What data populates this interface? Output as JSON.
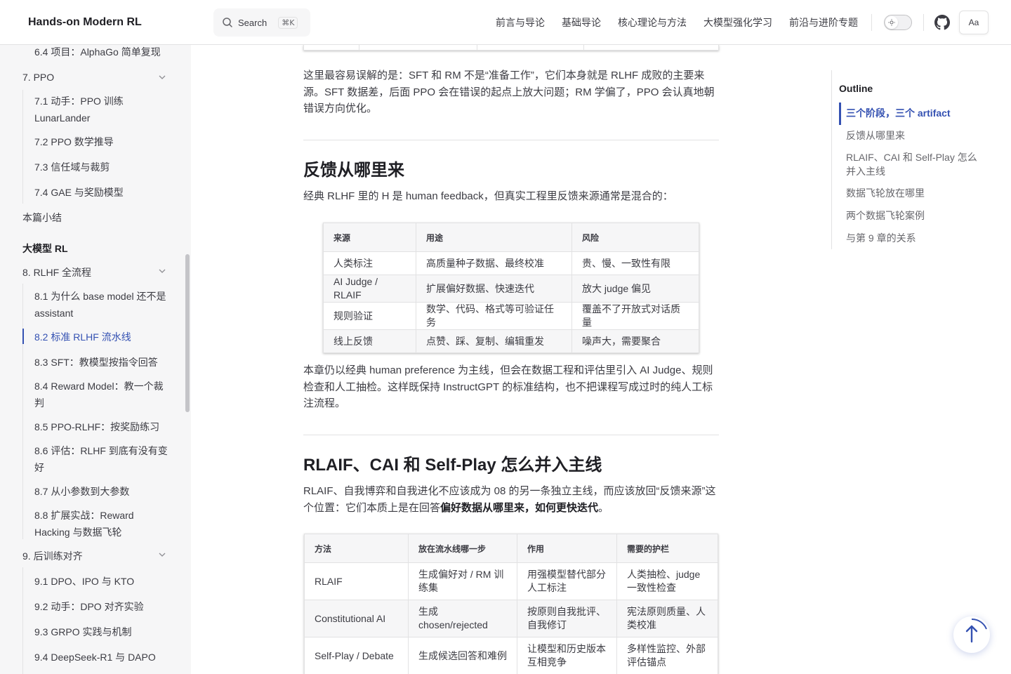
{
  "header": {
    "brand": "Hands-on Modern RL",
    "search_label": "Search",
    "search_shortcut": "⌘K",
    "nav": [
      "前言与导论",
      "基础导论",
      "核心理论与方法",
      "大模型强化学习",
      "前沿与进阶专题"
    ],
    "appearance_label": "Aa"
  },
  "sidebar": {
    "items": [
      {
        "label": "6.4 项目：AlphaGo 简单复现",
        "kind": "sub"
      },
      {
        "label": "7. PPO",
        "kind": "section"
      },
      {
        "label": "7.1 动手：PPO 训练 LunarLander",
        "kind": "sub"
      },
      {
        "label": "7.2 PPO 数学推导",
        "kind": "sub"
      },
      {
        "label": "7.3 信任域与裁剪",
        "kind": "sub"
      },
      {
        "label": "7.4 GAE 与奖励模型",
        "kind": "sub"
      },
      {
        "label": "本篇小结",
        "kind": "section"
      },
      {
        "label": "大模型 RL",
        "kind": "group"
      },
      {
        "label": "8. RLHF 全流程",
        "kind": "section"
      },
      {
        "label": "8.1 为什么 base model 还不是 assistant",
        "kind": "sub"
      },
      {
        "label": "8.2 标准 RLHF 流水线",
        "kind": "sub-active"
      },
      {
        "label": "8.3 SFT：教模型按指令回答",
        "kind": "sub"
      },
      {
        "label": "8.4 Reward Model：教一个裁判",
        "kind": "sub"
      },
      {
        "label": "8.5 PPO-RLHF：按奖励练习",
        "kind": "sub"
      },
      {
        "label": "8.6 评估：RLHF 到底有没有变好",
        "kind": "sub"
      },
      {
        "label": "8.7 从小参数到大参数",
        "kind": "sub"
      },
      {
        "label": "8.8 扩展实战：Reward Hacking 与数据飞轮",
        "kind": "sub"
      },
      {
        "label": "9. 后训练对齐",
        "kind": "section"
      },
      {
        "label": "9.1 DPO、IPO 与 KTO",
        "kind": "sub"
      },
      {
        "label": "9.2 动手：DPO 对齐实验",
        "kind": "sub"
      },
      {
        "label": "9.3 GRPO 实践与机制",
        "kind": "sub"
      },
      {
        "label": "9.4 DeepSeek-R1 与 DAPO",
        "kind": "sub"
      }
    ]
  },
  "content": {
    "para1": "这里最容易误解的是：SFT 和 RM 不是“准备工作”，它们本身就是 RLHF 成败的主要来源。SFT 数据差，后面 PPO 会在错误的起点上放大问题；RM 学偏了，PPO 会认真地朝错误方向优化。",
    "h2_feedback": "反馈从哪里来",
    "para2": "经典 RLHF 里的 H 是 human feedback，但真实工程里反馈来源通常是混合的：",
    "table1": {
      "headers": [
        "来源",
        "用途",
        "风险"
      ],
      "rows": [
        [
          "人类标注",
          "高质量种子数据、最终校准",
          "贵、慢、一致性有限"
        ],
        [
          "AI Judge / RLAIF",
          "扩展偏好数据、快速迭代",
          "放大 judge 偏见"
        ],
        [
          "规则验证",
          "数学、代码、格式等可验证任务",
          "覆盖不了开放式对话质量"
        ],
        [
          "线上反馈",
          "点赞、踩、复制、编辑重发",
          "噪声大，需要聚合"
        ]
      ]
    },
    "para3": "本章仍以经典 human preference 为主线，但会在数据工程和评估里引入 AI Judge、规则检查和人工抽检。这样既保持 InstructGPT 的标准结构，也不把课程写成过时的纯人工标注流程。",
    "h2_rlaif": "RLAIF、CAI 和 Self-Play 怎么并入主线",
    "para4_a": "RLAIF、自我博弈和自我进化不应该成为 08 的另一条独立主线，而应该放回“反馈来源”这个位置：它们本质上是在回答",
    "para4_bold": "偏好数据从哪里来，如何更快迭代",
    "para4_c": "。",
    "table2": {
      "headers": [
        "方法",
        "放在流水线哪一步",
        "作用",
        "需要的护栏"
      ],
      "rows": [
        [
          "RLAIF",
          "生成偏好对 / RM 训练集",
          "用强模型替代部分人工标注",
          "人类抽检、judge 一致性检查"
        ],
        [
          "Constitutional AI",
          "生成 chosen/rejected",
          "按原则自我批评、自我修订",
          "宪法原则质量、人类校准"
        ],
        [
          "Self-Play / Debate",
          "生成候选回答和难例",
          "让模型和历史版本互相竞争",
          "多样性监控、外部评估锚点"
        ]
      ]
    }
  },
  "outline": {
    "title": "Outline",
    "items": [
      "三个阶段，三个 artifact",
      "反馈从哪里来",
      "RLAIF、CAI 和 Self-Play 怎么并入主线",
      "数据飞轮放在哪里",
      "两个数据飞轮案例",
      "与第 9 章的关系"
    ]
  },
  "colors": {
    "accent": "#3451b2",
    "sidebar_bg": "#f6f6f7",
    "text": "#3c3c43"
  }
}
